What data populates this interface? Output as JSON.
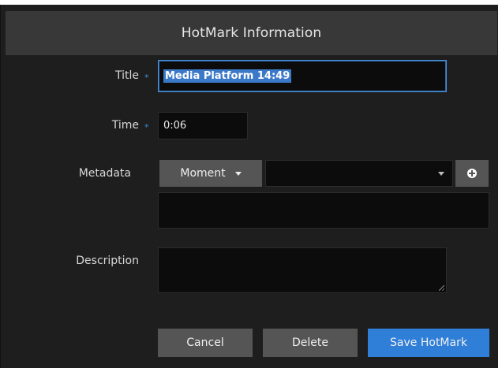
{
  "dialog": {
    "title": "HotMark Information"
  },
  "form": {
    "title_label": "Title",
    "title_value": "Media Platform 14:49",
    "time_label": "Time",
    "time_value": "0:06",
    "metadata_label": "Metadata",
    "metadata_type": "Moment",
    "metadata_value": "",
    "description_label": "Description",
    "description_value": "",
    "required_marker": "*"
  },
  "buttons": {
    "cancel": "Cancel",
    "delete": "Delete",
    "save": "Save HotMark"
  },
  "colors": {
    "accent": "#2f7ed8",
    "dialog_bg": "#1e1e1e",
    "header_bg": "#383838"
  }
}
